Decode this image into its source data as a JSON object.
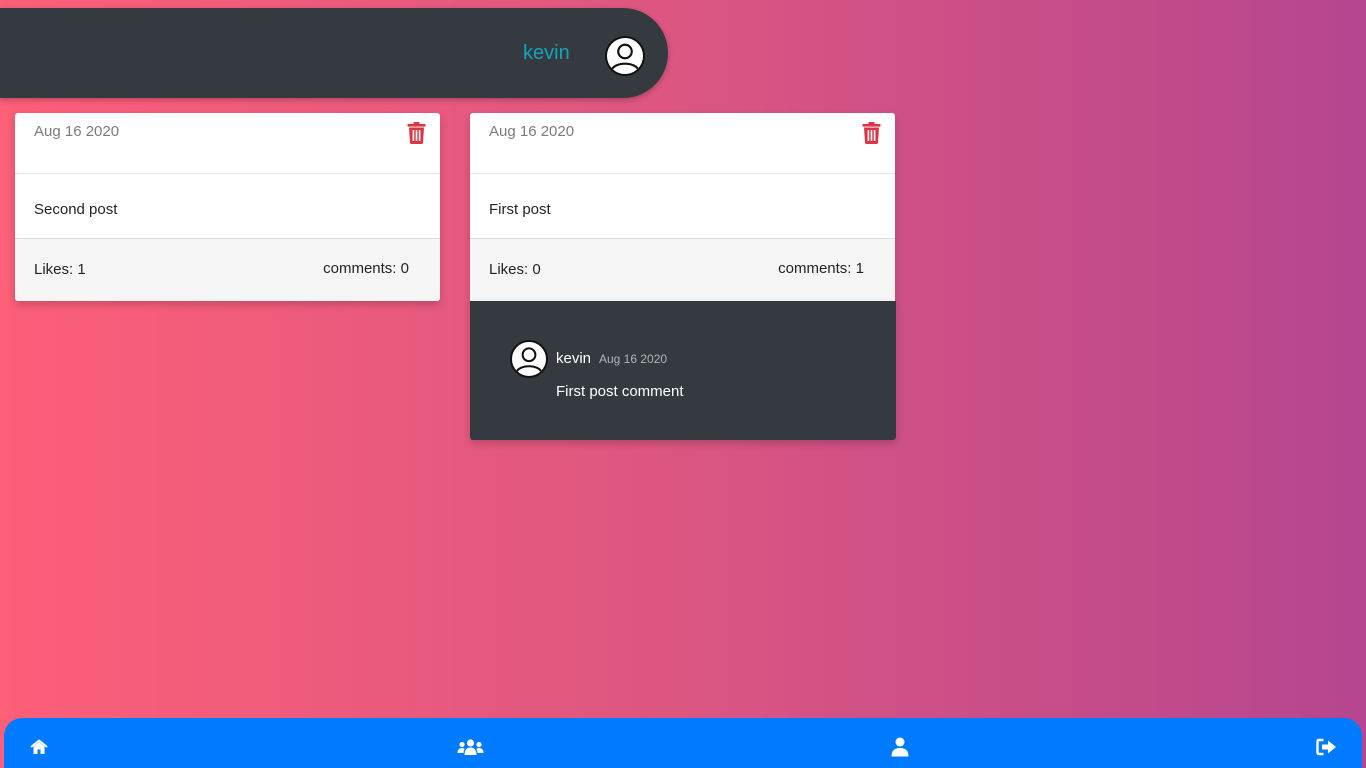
{
  "header": {
    "username": "kevin"
  },
  "posts": [
    {
      "date": "Aug 16 2020",
      "text": "Second post",
      "likes": "Likes: 1",
      "comments": "comments: 0"
    },
    {
      "date": "Aug 16 2020",
      "text": "First post",
      "likes": "Likes: 0",
      "comments": "comments: 1",
      "comment_list": [
        {
          "user": "kevin",
          "date": "Aug 16 2020",
          "text": "First post comment"
        }
      ]
    }
  ],
  "icons": {
    "avatar": "user-circle-icon",
    "delete": "trash-icon",
    "nav": [
      "home-icon",
      "users-icon",
      "user-icon",
      "sign-out-icon"
    ]
  },
  "colors": {
    "header_bg": "#343a40",
    "username": "#17a2b8",
    "delete": "#dc3545",
    "nav_bg": "#007bff"
  }
}
